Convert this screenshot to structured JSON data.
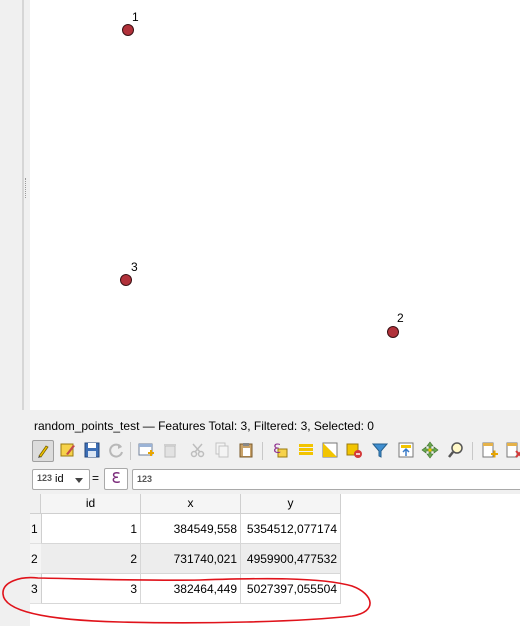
{
  "map": {
    "points": [
      {
        "label": "1"
      },
      {
        "label": "3"
      },
      {
        "label": "2"
      }
    ]
  },
  "attribute_table": {
    "title": "random_points_test — Features Total: 3, Filtered: 3, Selected: 0",
    "filter": {
      "field_type": "123",
      "field_name": "id",
      "operator": "=",
      "expression_icon": "ℇ",
      "value_type": "123",
      "value": ""
    },
    "columns": [
      "id",
      "x",
      "y"
    ],
    "rows": [
      {
        "num": "1",
        "id": "1",
        "x": "384549,558",
        "y": "5354512,077174"
      },
      {
        "num": "2",
        "id": "2",
        "x": "731740,021",
        "y": "4959900,477532"
      },
      {
        "num": "3",
        "id": "3",
        "x": "382464,449",
        "y": "5027397,055504"
      }
    ]
  },
  "toolbar_icons": [
    "toggle-editing-icon",
    "multi-edit-icon",
    "save-edits-icon",
    "reload-icon",
    "add-feature-icon",
    "delete-feature-icon",
    "cut-icon",
    "copy-icon",
    "paste-icon",
    "expression-select-icon",
    "select-all-icon",
    "invert-selection-icon",
    "deselect-all-icon",
    "filter-icon",
    "move-selection-top-icon",
    "pan-to-selection-icon",
    "zoom-to-selection-icon",
    "new-field-icon",
    "delete-field-icon"
  ],
  "colors": {
    "point_fill": "#b1313a",
    "annotation_stroke": "#e0131b"
  }
}
